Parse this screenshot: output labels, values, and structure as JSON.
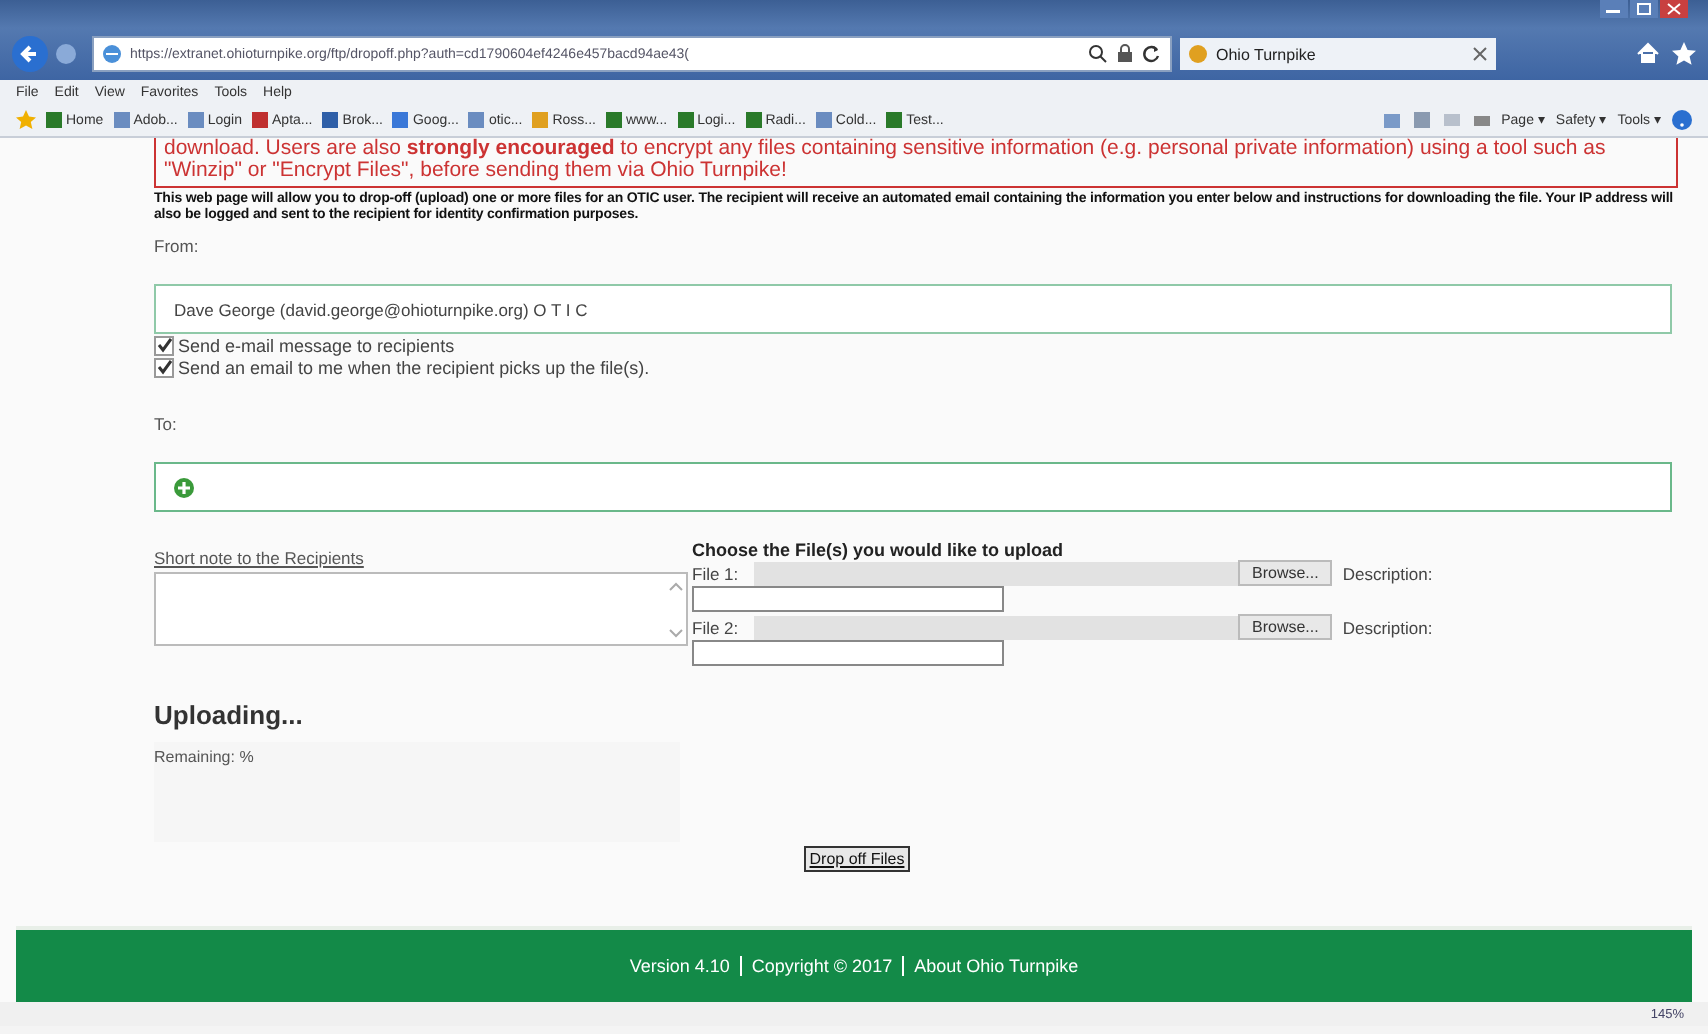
{
  "browser": {
    "address": "https://extranet.ohioturnpike.org/ftp/dropoff.php?auth=cd1790604ef4246e457bacd94ae43(",
    "tab": "Ohio Turnpike",
    "menu": [
      "File",
      "Edit",
      "View",
      "Favorites",
      "Tools",
      "Help"
    ],
    "favorites": [
      {
        "label": "Home",
        "color": "#2a7a2a"
      },
      {
        "label": "Adob...",
        "color": "#6a8cc0"
      },
      {
        "label": "Login",
        "color": "#6a8cc0"
      },
      {
        "label": "Apta...",
        "color": "#c03030"
      },
      {
        "label": "Brok...",
        "color": "#2f5fa8"
      },
      {
        "label": "Goog...",
        "color": "#3a78d8"
      },
      {
        "label": "otic...",
        "color": "#6a8cc0"
      },
      {
        "label": "Ross...",
        "color": "#e0a020"
      },
      {
        "label": "www...",
        "color": "#2a7a2a"
      },
      {
        "label": "Logi...",
        "color": "#2a7a2a"
      },
      {
        "label": "Radi...",
        "color": "#2a7a2a"
      },
      {
        "label": "Cold...",
        "color": "#6a8cc0"
      },
      {
        "label": "Test...",
        "color": "#2a7a2a"
      }
    ],
    "commands": [
      "Page ▾",
      "Safety ▾",
      "Tools ▾"
    ],
    "zoom": "145%"
  },
  "warning": "download. Users are also **strongly encouraged** to encrypt any files containing sensitive information (e.g. personal private information) using a tool such as \"Winzip\" or \"Encrypt Files\", before sending them via Ohio Turnpike!",
  "intro": "This web page will allow you to drop-off (upload) one or more files for an OTIC user. The recipient will receive an automated email containing the information you enter below and instructions for downloading the file. Your IP address will also be logged and sent to the recipient for identity confirmation purposes.",
  "from_label": "From:",
  "from_value": "Dave George (david.george@ohioturnpike.org) O T I C",
  "options": [
    {
      "label": "Send e-mail message to recipients",
      "checked": true
    },
    {
      "label": "Send an email to me when the recipient picks up the file(s).",
      "checked": true
    }
  ],
  "to_label": "To:",
  "note_label": "Short note to the Recipients",
  "files_heading": "Choose the File(s) you would like to upload",
  "files": [
    {
      "label": "File 1:",
      "button": "Browse...",
      "description_label": "Description:"
    },
    {
      "label": "File 2:",
      "button": "Browse...",
      "description_label": "Description:"
    }
  ],
  "uploading": "Uploading...",
  "remaining": "Remaining: %",
  "submit": "Drop off Files",
  "footer": [
    "Version 4.10",
    "Copyright © 2017",
    "About Ohio Turnpike"
  ]
}
